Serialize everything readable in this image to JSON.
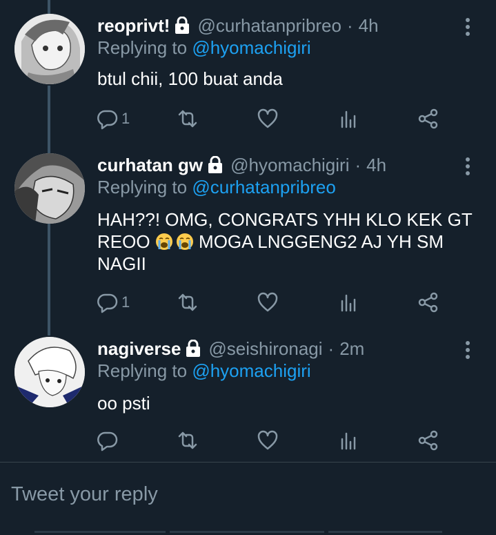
{
  "colors": {
    "background": "#15202b",
    "text_primary": "#ffffff",
    "text_secondary": "#8899a6",
    "link": "#1da1f2",
    "thread_line": "#3d5466"
  },
  "tweets": [
    {
      "display_name": "reoprivt!",
      "handle": "@curhatanpribreo",
      "separator": "·",
      "time": "4h",
      "replying_prefix": "Replying to",
      "replying_to": "@hyomachigiri",
      "text": "btul chii, 100 buat anda",
      "reply_count": "1"
    },
    {
      "display_name": "curhatan gw",
      "handle": "@hyomachigiri",
      "separator": "·",
      "time": "4h",
      "replying_prefix": "Replying to",
      "replying_to": "@curhatanpribreo",
      "text_part1": "HAH??! OMG, CONGRATS YHH KLO KEK GT REOO",
      "text_part2": "MOGA LNGGENG2 AJ YH SM NAGII",
      "emoji": "loudly-crying-face",
      "reply_count": "1"
    },
    {
      "display_name": "nagiverse",
      "handle": "@seishironagi",
      "separator": "·",
      "time": "2m",
      "replying_prefix": "Replying to",
      "replying_to": "@hyomachigiri",
      "text": "oo psti",
      "reply_count": ""
    }
  ],
  "compose": {
    "placeholder": "Tweet your reply"
  }
}
